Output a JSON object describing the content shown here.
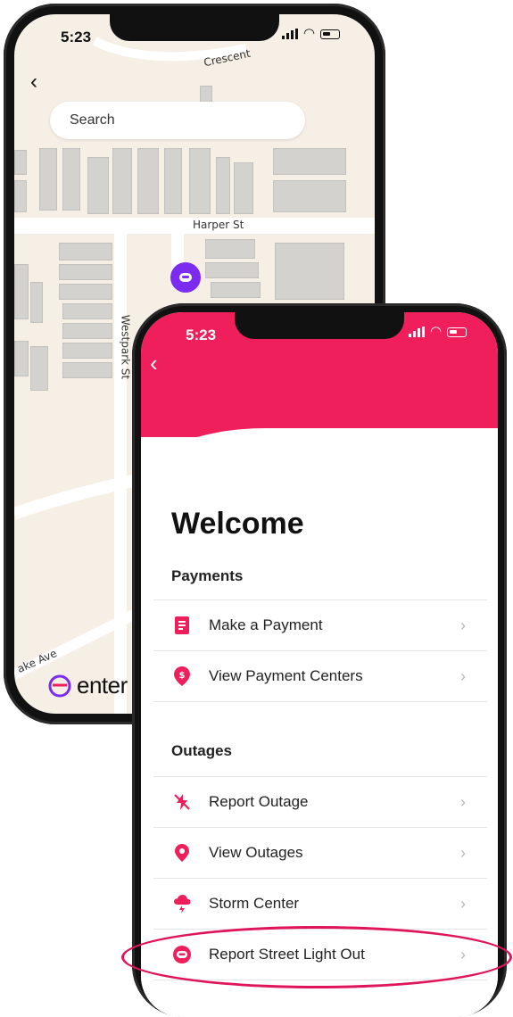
{
  "map_phone": {
    "time": "5:23",
    "search_placeholder": "Search",
    "streets": {
      "crescent": "Crescent",
      "harper": "Harper St",
      "westpark": "Westpark St",
      "lake": "ake Ave"
    },
    "brand_text": "enter"
  },
  "app_phone": {
    "time": "5:23",
    "title": "Welcome",
    "sections": [
      {
        "title": "Payments",
        "items": [
          {
            "label": "Make a Payment"
          },
          {
            "label": "View Payment Centers"
          }
        ]
      },
      {
        "title": "Outages",
        "items": [
          {
            "label": "Report Outage"
          },
          {
            "label": "View Outages"
          },
          {
            "label": "Storm Center"
          },
          {
            "label": "Report Street Light Out"
          }
        ]
      }
    ]
  },
  "colors": {
    "accent": "#ee1f5b",
    "pin": "#7b2cf0",
    "highlight": "#e0145b"
  },
  "icons": [
    "back-arrow-icon",
    "payment-bill-icon",
    "dollar-location-icon",
    "power-off-icon",
    "location-pin-icon",
    "storm-cloud-icon",
    "street-light-icon",
    "chevron-right-icon"
  ]
}
